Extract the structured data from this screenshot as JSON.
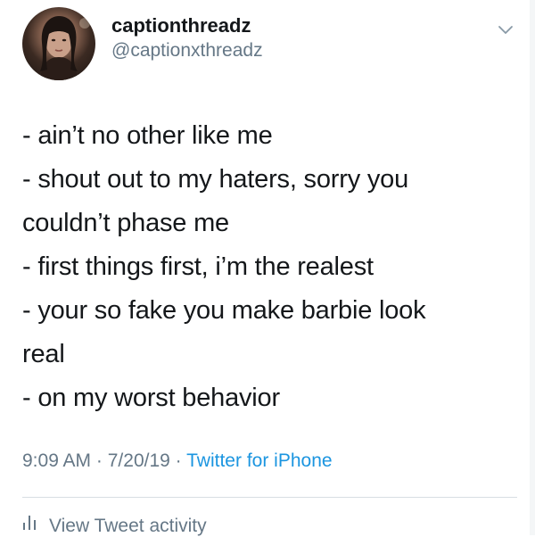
{
  "user": {
    "display_name": "captionthreadz",
    "handle": "@captionxthreadz"
  },
  "tweet": {
    "lines": [
      "- ain’t no other like me",
      "- shout out to my haters, sorry you",
      "couldn’t phase me",
      "- first things first, i’m the realest",
      "-  your so fake you make barbie look",
      "real",
      "- on my worst behavior"
    ],
    "time": "9:09 AM",
    "separator": "·",
    "date": "7/20/19",
    "source": "Twitter for iPhone"
  },
  "actions": {
    "activity_label": "View Tweet activity"
  },
  "icons": {
    "menu": "chevron-down-icon",
    "activity": "bar-chart-icon"
  },
  "colors": {
    "text_primary": "#14171a",
    "text_secondary": "#657786",
    "link": "#1b95e0",
    "divider": "#d8dee3"
  }
}
